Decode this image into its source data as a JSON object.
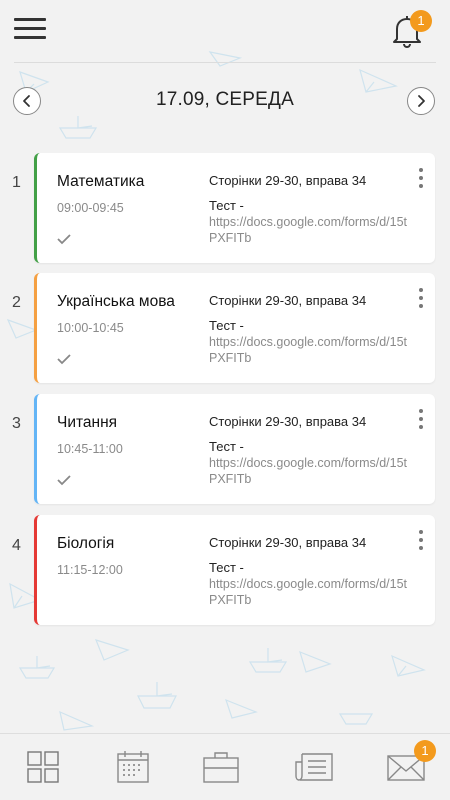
{
  "header": {
    "notification_count": "1"
  },
  "date_nav": {
    "title": "17.09, СЕРЕДА"
  },
  "lessons": [
    {
      "number": "1",
      "subject": "Математика",
      "time": "09:00-09:45",
      "homework": "Сторінки 29-30, вправа 34",
      "test_label": "Тест -",
      "test_link": "https://docs.google.com/forms/d/15tPXFITb",
      "accent": "#43a047",
      "done": true
    },
    {
      "number": "2",
      "subject": "Українська мова",
      "time": "10:00-10:45",
      "homework": "Сторінки 29-30, вправа 34",
      "test_label": "Тест -",
      "test_link": "https://docs.google.com/forms/d/15tPXFITb",
      "accent": "#f5a042",
      "done": true
    },
    {
      "number": "3",
      "subject": "Читання",
      "time": "10:45-11:00",
      "homework": "Сторінки 29-30, вправа 34",
      "test_label": "Тест -",
      "test_link": "https://docs.google.com/forms/d/15tPXFITb",
      "accent": "#64b5f6",
      "done": true
    },
    {
      "number": "4",
      "subject": "Біологія",
      "time": "11:15-12:00",
      "homework": "Сторінки 29-30, вправа 34",
      "test_label": "Тест -",
      "test_link": "https://docs.google.com/forms/d/15tPXFITb",
      "accent": "#e53935",
      "done": false
    }
  ],
  "bottom_nav": {
    "tabs": [
      {
        "icon": "grid-icon"
      },
      {
        "icon": "calendar-icon"
      },
      {
        "icon": "briefcase-icon"
      },
      {
        "icon": "newspaper-icon"
      },
      {
        "icon": "envelope-icon"
      }
    ],
    "messages_count": "1"
  },
  "colors": {
    "badge": "#f39a1d",
    "background": "#f2f2f2"
  }
}
